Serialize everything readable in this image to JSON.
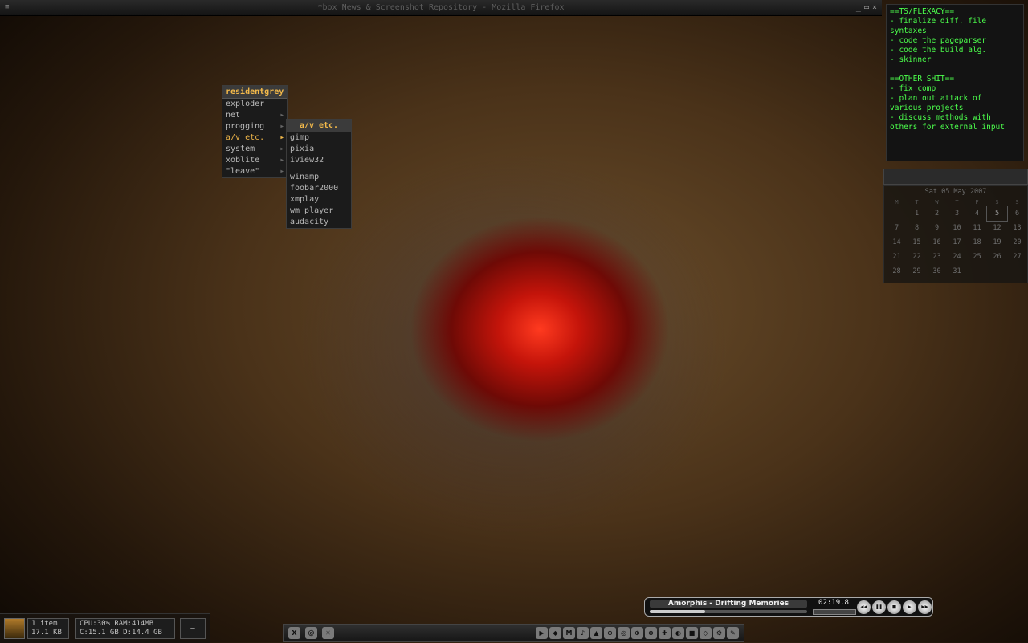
{
  "window": {
    "title": "*box News & Screenshot Repository - Mozilla Firefox",
    "menu_glyph": "≡",
    "min": "_",
    "max": "▭",
    "close": "×"
  },
  "notes": {
    "lines": [
      "==TS/FLEXACY==",
      "- finalize diff. file",
      "syntaxes",
      "- code the pageparser",
      "- code the build alg.",
      "- skinner",
      "",
      "==OTHER SHIT==",
      "- fix comp",
      "- plan out attack of",
      "various projects",
      "- discuss methods with",
      "others for external input"
    ]
  },
  "calendar": {
    "title": "Sat 05 May  2007",
    "weekdays": [
      "M",
      "T",
      "W",
      "T",
      "F",
      "S",
      "S"
    ],
    "rows": [
      [
        "",
        "1",
        "2",
        "3",
        "4",
        "5",
        "6"
      ],
      [
        "7",
        "8",
        "9",
        "10",
        "11",
        "12",
        "13"
      ],
      [
        "14",
        "15",
        "16",
        "17",
        "18",
        "19",
        "20"
      ],
      [
        "21",
        "22",
        "23",
        "24",
        "25",
        "26",
        "27"
      ],
      [
        "28",
        "29",
        "30",
        "31",
        "",
        "",
        ""
      ]
    ],
    "today": "5"
  },
  "root_menu": {
    "title": "residentgrey",
    "items": [
      "exploder",
      "net",
      "progging",
      "a/v etc.",
      "system",
      "xoblite",
      "\"leave\""
    ],
    "submenu_items": [
      "net",
      "progging",
      "a/v etc.",
      "system",
      "xoblite",
      "\"leave\""
    ],
    "active": "a/v etc."
  },
  "av_menu": {
    "title": "a/v etc.",
    "group1": [
      "gimp",
      "pixia",
      "iview32"
    ],
    "group2": [
      "winamp",
      "foobar2000",
      "xmplay",
      "wm player",
      "audacity"
    ]
  },
  "player": {
    "track": "Amorphis - Drifting Memories",
    "time": "02:19.8",
    "progress": 0.35,
    "buttons": [
      "◀◀",
      "❚❚",
      "■",
      "▶",
      "▶▶"
    ]
  },
  "stats": {
    "items": "1 item",
    "size": "17.1 KB",
    "cpu_ram": "CPU:30% RAM:414MB",
    "disks": "C:15.1 GB D:14.4 GB",
    "button": "–"
  },
  "taskbar": {
    "left_icons": [
      "X",
      "@",
      "☼"
    ],
    "tray_icons": [
      "▶",
      "◆",
      "M",
      "♪",
      "▲",
      "⊙",
      "◎",
      "⊕",
      "⊗",
      "✚",
      "◐",
      "■",
      "◇",
      "⚙",
      "✎"
    ]
  }
}
